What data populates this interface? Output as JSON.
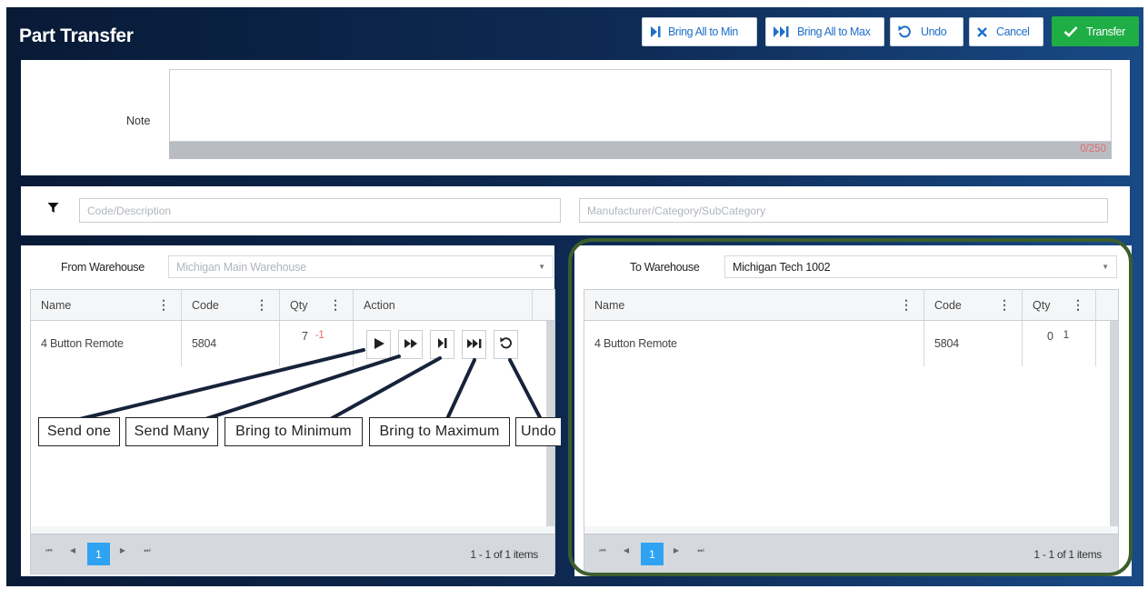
{
  "header": {
    "title": "Part Transfer",
    "buttons": {
      "bring_all_min": "Bring All to Min",
      "bring_all_max": "Bring All to Max",
      "undo": "Undo",
      "cancel": "Cancel",
      "transfer": "Transfer"
    }
  },
  "note": {
    "label": "Note",
    "value": "",
    "counter": "0/250"
  },
  "filter": {
    "code_placeholder": "Code/Description",
    "category_placeholder": "Manufacturer/Category/SubCategory"
  },
  "from": {
    "label": "From Warehouse",
    "warehouse": "Michigan Main Warehouse",
    "columns": [
      "Name",
      "Code",
      "Qty",
      "Action"
    ],
    "rows": [
      {
        "name": "4 Button Remote",
        "code": "5804",
        "qty": "7",
        "change": "-1"
      }
    ],
    "page": "1",
    "info": "1 - 1 of 1 items"
  },
  "to": {
    "label": "To Warehouse",
    "warehouse": "Michigan Tech 1002",
    "columns": [
      "Name",
      "Code",
      "Qty"
    ],
    "rows": [
      {
        "name": "4 Button Remote",
        "code": "5804",
        "qty": "0",
        "change": "1"
      }
    ],
    "page": "1",
    "info": "1 - 1 of 1 items"
  },
  "callouts": {
    "send_one": "Send one",
    "send_many": "Send Many",
    "bring_min": "Bring to Minimum",
    "bring_max": "Bring to Maximum",
    "undo": "Undo"
  },
  "colors": {
    "accent": "#2ea3f2",
    "link": "#1e6fc9",
    "transfer": "#1fae45",
    "negative": "#e46b6b",
    "highlight": "#3b5e2c"
  }
}
